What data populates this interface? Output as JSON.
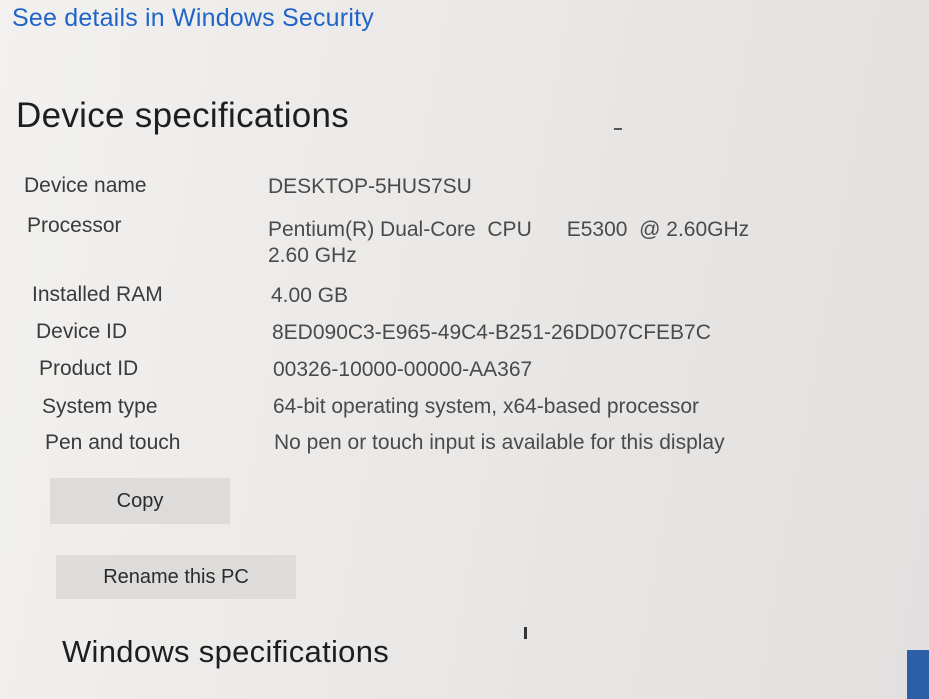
{
  "security_link": "See details in Windows Security",
  "device_specs": {
    "title": "Device specifications",
    "rows": [
      {
        "label": "Device name",
        "value": "DESKTOP-5HUS7SU"
      },
      {
        "label": "Processor",
        "value": "Pentium(R) Dual-Core  CPU      E5300  @ 2.60GHz",
        "value_line2": "2.60 GHz"
      },
      {
        "label": "Installed RAM",
        "value": "4.00 GB"
      },
      {
        "label": "Device ID",
        "value": "8ED090C3-E965-49C4-B251-26DD07CFEB7C"
      },
      {
        "label": "Product ID",
        "value": "00326-10000-00000-AA367"
      },
      {
        "label": "System type",
        "value": "64-bit operating system, x64-based processor"
      },
      {
        "label": "Pen and touch",
        "value": "No pen or touch input is available for this display"
      }
    ]
  },
  "buttons": {
    "copy": "Copy",
    "rename": "Rename this PC"
  },
  "windows_specs": {
    "title": "Windows specifications"
  },
  "colors": {
    "link": "#1f64c8",
    "accent_edge": "#2c5fa8"
  }
}
